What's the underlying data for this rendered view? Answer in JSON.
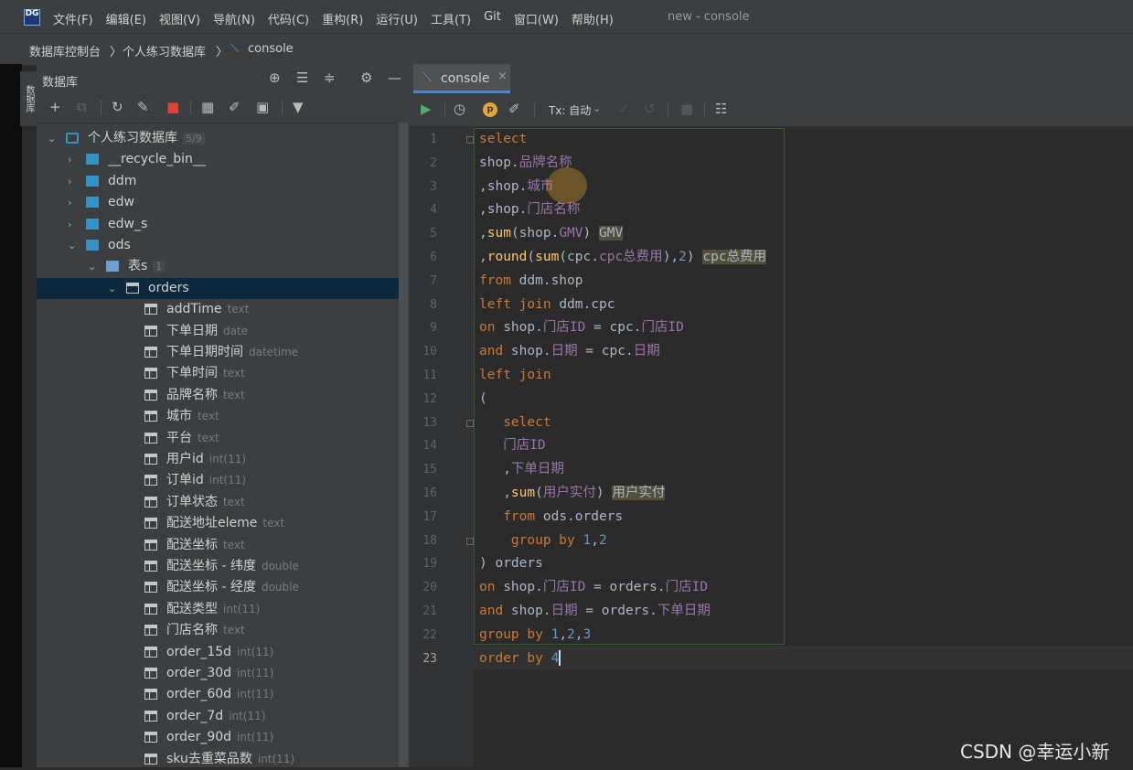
{
  "app": {
    "logo": "DG",
    "window_title": "new - console",
    "menus": [
      "文件(F)",
      "编辑(E)",
      "视图(V)",
      "导航(N)",
      "代码(C)",
      "重构(R)",
      "运行(U)",
      "工具(T)",
      "Git",
      "窗口(W)",
      "帮助(H)"
    ]
  },
  "breadcrumb": [
    "数据库控制台",
    "个人练习数据库",
    "console"
  ],
  "stripe_tab": "数据库",
  "db_panel": {
    "title": "数据库",
    "tree": [
      {
        "depth": 0,
        "kind": "db",
        "label": "个人练习数据库",
        "badge": "5/9",
        "open": true
      },
      {
        "depth": 1,
        "kind": "schema",
        "label": "__recycle_bin__",
        "open": false
      },
      {
        "depth": 1,
        "kind": "schema",
        "label": "ddm",
        "open": false
      },
      {
        "depth": 1,
        "kind": "schema",
        "label": "edw",
        "open": false
      },
      {
        "depth": 1,
        "kind": "schema",
        "label": "edw_s",
        "open": false
      },
      {
        "depth": 1,
        "kind": "schema",
        "label": "ods",
        "open": true
      },
      {
        "depth": 2,
        "kind": "folder",
        "label": "表s",
        "badge": "1",
        "open": true
      },
      {
        "depth": 3,
        "kind": "table",
        "label": "orders",
        "open": true,
        "selected": true
      },
      {
        "depth": 4,
        "kind": "col",
        "label": "addTime",
        "type": "text"
      },
      {
        "depth": 4,
        "kind": "col",
        "label": "下单日期",
        "type": "date"
      },
      {
        "depth": 4,
        "kind": "col",
        "label": "下单日期时间",
        "type": "datetime"
      },
      {
        "depth": 4,
        "kind": "col",
        "label": "下单时间",
        "type": "text"
      },
      {
        "depth": 4,
        "kind": "col",
        "label": "品牌名称",
        "type": "text"
      },
      {
        "depth": 4,
        "kind": "col",
        "label": "城市",
        "type": "text"
      },
      {
        "depth": 4,
        "kind": "col",
        "label": "平台",
        "type": "text"
      },
      {
        "depth": 4,
        "kind": "col",
        "label": "用户id",
        "type": "int(11)"
      },
      {
        "depth": 4,
        "kind": "col",
        "label": "订单id",
        "type": "int(11)"
      },
      {
        "depth": 4,
        "kind": "col",
        "label": "订单状态",
        "type": "text"
      },
      {
        "depth": 4,
        "kind": "col",
        "label": "配送地址eleme",
        "type": "text"
      },
      {
        "depth": 4,
        "kind": "col",
        "label": "配送坐标",
        "type": "text"
      },
      {
        "depth": 4,
        "kind": "col",
        "label": "配送坐标 - 纬度",
        "type": "double"
      },
      {
        "depth": 4,
        "kind": "col",
        "label": "配送坐标 - 经度",
        "type": "double"
      },
      {
        "depth": 4,
        "kind": "col",
        "label": "配送类型",
        "type": "int(11)"
      },
      {
        "depth": 4,
        "kind": "col",
        "label": "门店名称",
        "type": "text"
      },
      {
        "depth": 4,
        "kind": "col",
        "label": "order_15d",
        "type": "int(11)"
      },
      {
        "depth": 4,
        "kind": "col",
        "label": "order_30d",
        "type": "int(11)"
      },
      {
        "depth": 4,
        "kind": "col",
        "label": "order_60d",
        "type": "int(11)"
      },
      {
        "depth": 4,
        "kind": "col",
        "label": "order_7d",
        "type": "int(11)"
      },
      {
        "depth": 4,
        "kind": "col",
        "label": "order_90d",
        "type": "int(11)"
      },
      {
        "depth": 4,
        "kind": "col",
        "label": "sku去重菜品数",
        "type": "int(11)"
      }
    ]
  },
  "editor": {
    "tab_label": "console",
    "tx_label": "Tx: 自动",
    "current_line": 23,
    "lines": [
      [
        [
          "k",
          "select"
        ]
      ],
      [
        [
          "c",
          "shop."
        ],
        [
          "p",
          "品牌名称"
        ]
      ],
      [
        [
          "c",
          ",shop."
        ],
        [
          "p",
          "城市"
        ]
      ],
      [
        [
          "c",
          ",shop."
        ],
        [
          "p",
          "门店名称"
        ]
      ],
      [
        [
          "c",
          ","
        ],
        [
          "f",
          "sum"
        ],
        [
          "c",
          "(shop."
        ],
        [
          "p",
          "GMV"
        ],
        [
          "c",
          ") "
        ],
        [
          "hl",
          "GMV"
        ]
      ],
      [
        [
          "c",
          ","
        ],
        [
          "f",
          "round"
        ],
        [
          "c",
          "("
        ],
        [
          "f",
          "sum"
        ],
        [
          "c",
          "(cpc."
        ],
        [
          "p",
          "cpc总费用"
        ],
        [
          "c",
          "),"
        ],
        [
          "n",
          "2"
        ],
        [
          "c",
          ") "
        ],
        [
          "hl",
          "cpc总费用"
        ]
      ],
      [
        [
          "k",
          "from "
        ],
        [
          "c",
          "ddm.shop"
        ]
      ],
      [
        [
          "k",
          "left join "
        ],
        [
          "c",
          "ddm.cpc"
        ]
      ],
      [
        [
          "k",
          "on "
        ],
        [
          "c",
          "shop."
        ],
        [
          "p",
          "门店ID"
        ],
        [
          "c",
          " = cpc."
        ],
        [
          "p",
          "门店ID"
        ]
      ],
      [
        [
          "k",
          "and "
        ],
        [
          "c",
          "shop."
        ],
        [
          "p",
          "日期"
        ],
        [
          "c",
          " = cpc."
        ],
        [
          "p",
          "日期"
        ]
      ],
      [
        [
          "k",
          "left join"
        ]
      ],
      [
        [
          "c",
          "("
        ]
      ],
      [
        [
          "c",
          "   "
        ],
        [
          "k",
          "select"
        ]
      ],
      [
        [
          "c",
          "   "
        ],
        [
          "p",
          "门店ID"
        ]
      ],
      [
        [
          "c",
          "   ,"
        ],
        [
          "p",
          "下单日期"
        ]
      ],
      [
        [
          "c",
          "   ,"
        ],
        [
          "f",
          "sum"
        ],
        [
          "c",
          "("
        ],
        [
          "p",
          "用户实付"
        ],
        [
          "c",
          ") "
        ],
        [
          "hl",
          "用户实付"
        ]
      ],
      [
        [
          "c",
          "   "
        ],
        [
          "k",
          "from "
        ],
        [
          "c",
          "ods.orders"
        ]
      ],
      [
        [
          "c",
          "    "
        ],
        [
          "k",
          "group by "
        ],
        [
          "n",
          "1"
        ],
        [
          "c",
          ","
        ],
        [
          "n",
          "2"
        ]
      ],
      [
        [
          "c",
          ") orders"
        ]
      ],
      [
        [
          "k",
          "on "
        ],
        [
          "c",
          "shop."
        ],
        [
          "p",
          "门店ID"
        ],
        [
          "c",
          " = orders."
        ],
        [
          "p",
          "门店ID"
        ]
      ],
      [
        [
          "k",
          "and "
        ],
        [
          "c",
          "shop."
        ],
        [
          "p",
          "日期"
        ],
        [
          "c",
          " = orders."
        ],
        [
          "p",
          "下单日期"
        ]
      ],
      [
        [
          "k",
          "group by "
        ],
        [
          "n",
          "1"
        ],
        [
          "c",
          ","
        ],
        [
          "n",
          "2"
        ],
        [
          "c",
          ","
        ],
        [
          "n",
          "3"
        ]
      ],
      [
        [
          "k",
          "order by "
        ],
        [
          "n",
          "4"
        ]
      ]
    ]
  },
  "watermark": "CSDN @幸运小新"
}
